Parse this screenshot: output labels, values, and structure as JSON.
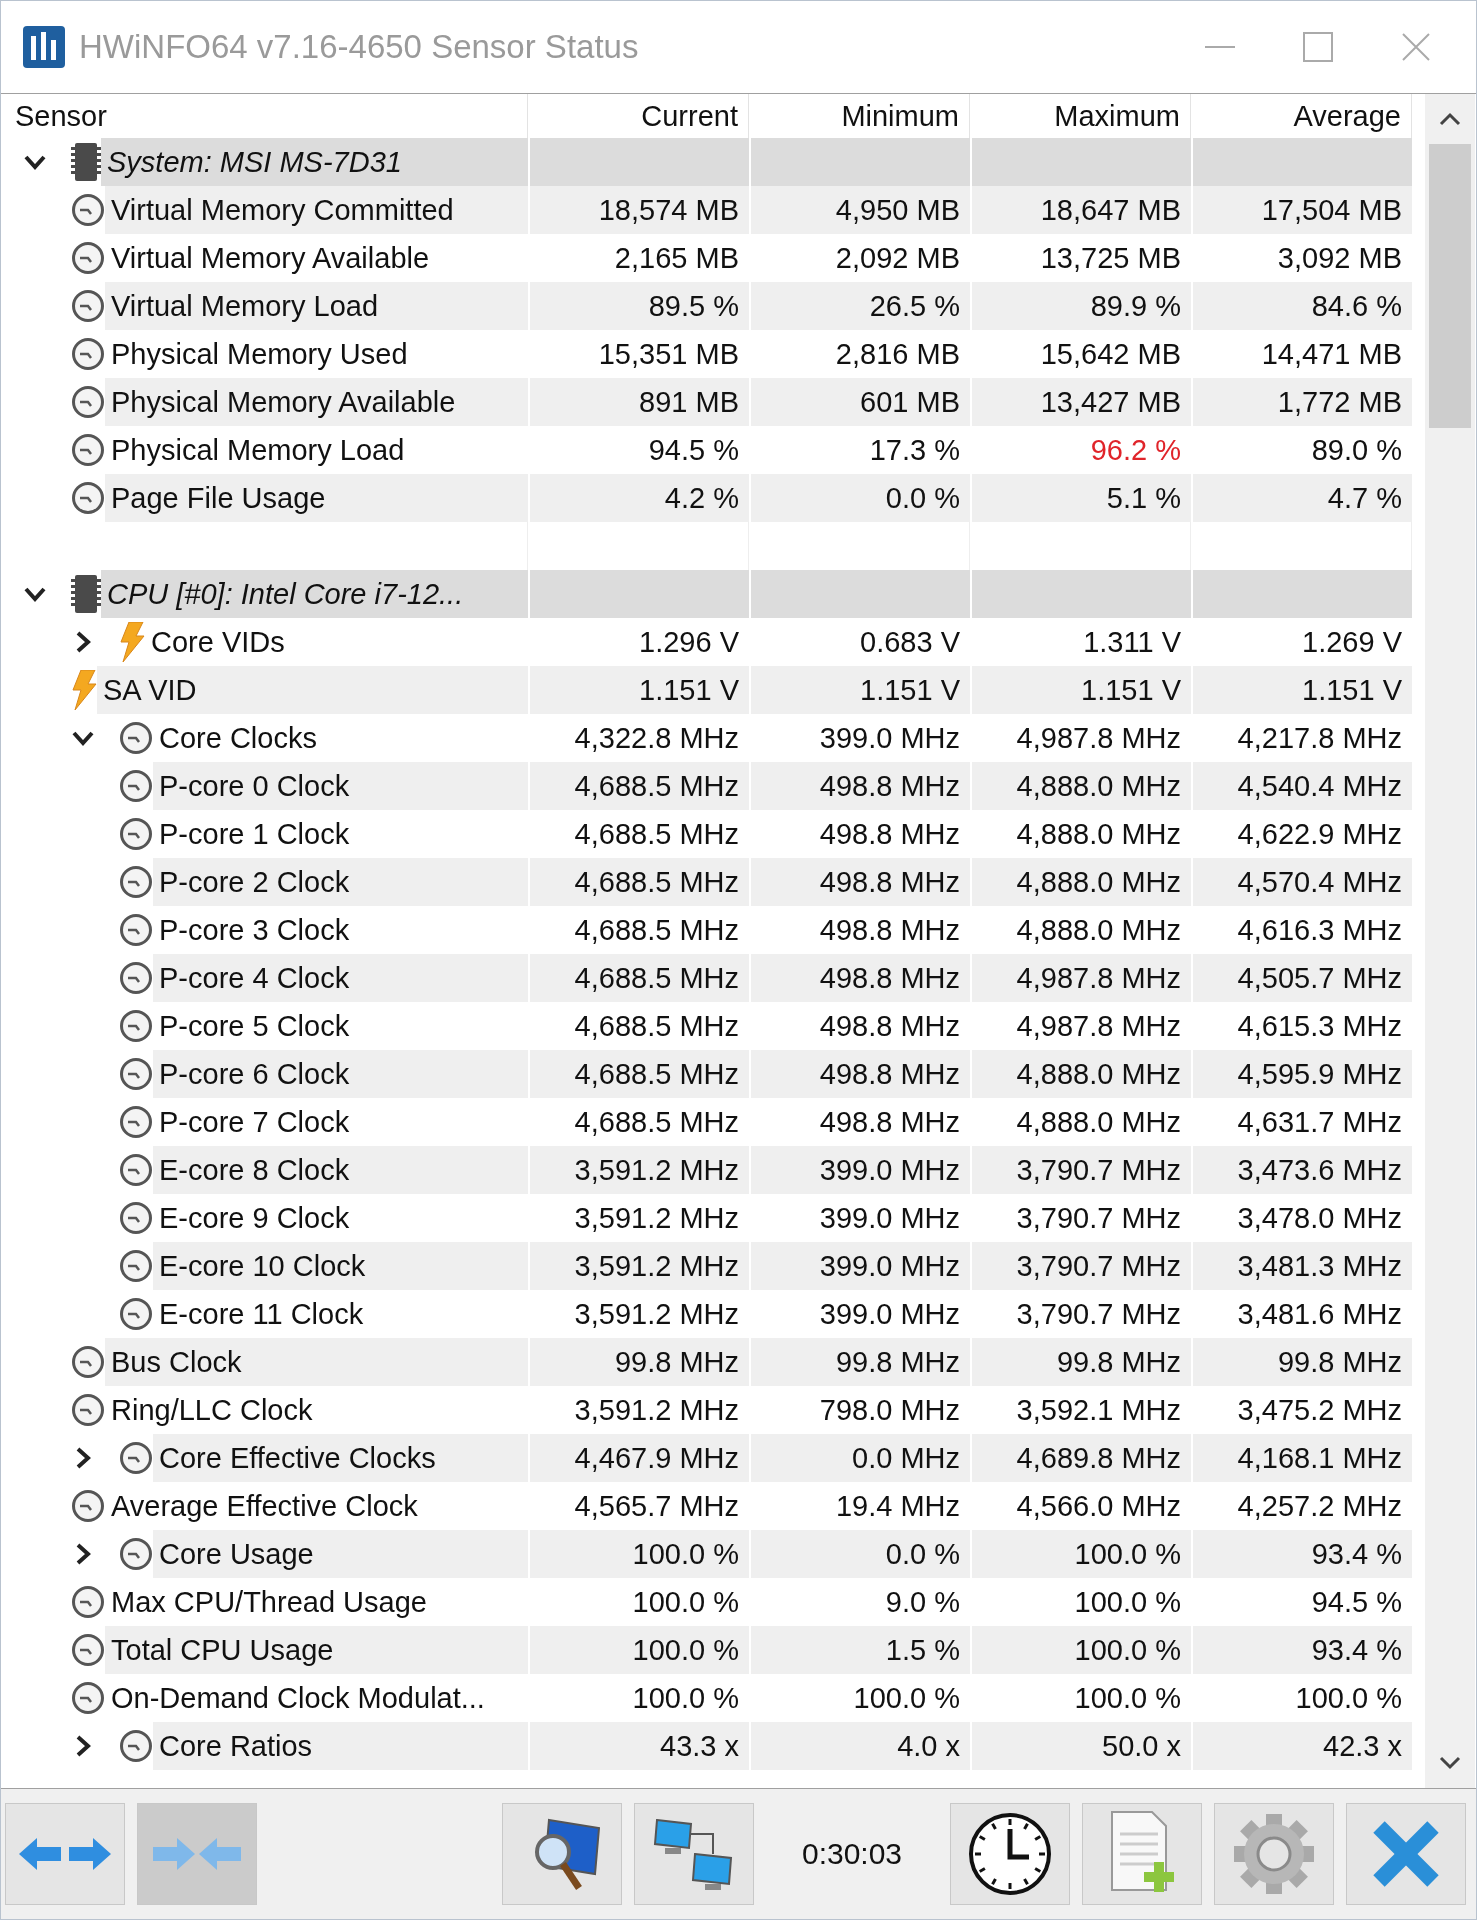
{
  "window": {
    "title": "HWiNFO64 v7.16-4650 Sensor Status"
  },
  "columns": [
    "Sensor",
    "Current",
    "Minimum",
    "Maximum",
    "Average"
  ],
  "groups": [
    {
      "label": "System: MSI MS-7D31",
      "expanded": true,
      "rows": [
        {
          "label": "Virtual Memory Committed",
          "kind": "clock",
          "values": [
            "18,574 MB",
            "4,950 MB",
            "18,647 MB",
            "17,504 MB"
          ],
          "max_alert": false
        },
        {
          "label": "Virtual Memory Available",
          "kind": "clock",
          "values": [
            "2,165 MB",
            "2,092 MB",
            "13,725 MB",
            "3,092 MB"
          ],
          "max_alert": false
        },
        {
          "label": "Virtual Memory Load",
          "kind": "clock",
          "values": [
            "89.5 %",
            "26.5 %",
            "89.9 %",
            "84.6 %"
          ],
          "max_alert": false
        },
        {
          "label": "Physical Memory Used",
          "kind": "clock",
          "values": [
            "15,351 MB",
            "2,816 MB",
            "15,642 MB",
            "14,471 MB"
          ],
          "max_alert": false
        },
        {
          "label": "Physical Memory Available",
          "kind": "clock",
          "values": [
            "891 MB",
            "601 MB",
            "13,427 MB",
            "1,772 MB"
          ],
          "max_alert": false
        },
        {
          "label": "Physical Memory Load",
          "kind": "clock",
          "values": [
            "94.5 %",
            "17.3 %",
            "96.2 %",
            "89.0 %"
          ],
          "max_alert": true
        },
        {
          "label": "Page File Usage",
          "kind": "clock",
          "values": [
            "4.2 %",
            "0.0 %",
            "5.1 %",
            "4.7 %"
          ],
          "max_alert": false
        }
      ]
    },
    {
      "label": "CPU [#0]: Intel Core i7-12...",
      "expanded": true,
      "rows": [
        {
          "label": "Core VIDs",
          "kind": "voltage",
          "expanded": false,
          "values": [
            "1.296 V",
            "0.683 V",
            "1.311 V",
            "1.269 V"
          ],
          "max_alert": false
        },
        {
          "label": "SA VID",
          "kind": "voltage",
          "values": [
            "1.151 V",
            "1.151 V",
            "1.151 V",
            "1.151 V"
          ],
          "max_alert": false
        },
        {
          "label": "Core Clocks",
          "kind": "clock",
          "expanded": true,
          "values": [
            "4,322.8 MHz",
            "399.0 MHz",
            "4,987.8 MHz",
            "4,217.8 MHz"
          ],
          "max_alert": false,
          "children": [
            {
              "label": "P-core 0 Clock",
              "kind": "clock",
              "values": [
                "4,688.5 MHz",
                "498.8 MHz",
                "4,888.0 MHz",
                "4,540.4 MHz"
              ],
              "max_alert": false
            },
            {
              "label": "P-core 1 Clock",
              "kind": "clock",
              "values": [
                "4,688.5 MHz",
                "498.8 MHz",
                "4,888.0 MHz",
                "4,622.9 MHz"
              ],
              "max_alert": false
            },
            {
              "label": "P-core 2 Clock",
              "kind": "clock",
              "values": [
                "4,688.5 MHz",
                "498.8 MHz",
                "4,888.0 MHz",
                "4,570.4 MHz"
              ],
              "max_alert": false
            },
            {
              "label": "P-core 3 Clock",
              "kind": "clock",
              "values": [
                "4,688.5 MHz",
                "498.8 MHz",
                "4,888.0 MHz",
                "4,616.3 MHz"
              ],
              "max_alert": false
            },
            {
              "label": "P-core 4 Clock",
              "kind": "clock",
              "values": [
                "4,688.5 MHz",
                "498.8 MHz",
                "4,987.8 MHz",
                "4,505.7 MHz"
              ],
              "max_alert": false
            },
            {
              "label": "P-core 5 Clock",
              "kind": "clock",
              "values": [
                "4,688.5 MHz",
                "498.8 MHz",
                "4,987.8 MHz",
                "4,615.3 MHz"
              ],
              "max_alert": false
            },
            {
              "label": "P-core 6 Clock",
              "kind": "clock",
              "values": [
                "4,688.5 MHz",
                "498.8 MHz",
                "4,888.0 MHz",
                "4,595.9 MHz"
              ],
              "max_alert": false
            },
            {
              "label": "P-core 7 Clock",
              "kind": "clock",
              "values": [
                "4,688.5 MHz",
                "498.8 MHz",
                "4,888.0 MHz",
                "4,631.7 MHz"
              ],
              "max_alert": false
            },
            {
              "label": "E-core 8 Clock",
              "kind": "clock",
              "values": [
                "3,591.2 MHz",
                "399.0 MHz",
                "3,790.7 MHz",
                "3,473.6 MHz"
              ],
              "max_alert": false
            },
            {
              "label": "E-core 9 Clock",
              "kind": "clock",
              "values": [
                "3,591.2 MHz",
                "399.0 MHz",
                "3,790.7 MHz",
                "3,478.0 MHz"
              ],
              "max_alert": false
            },
            {
              "label": "E-core 10 Clock",
              "kind": "clock",
              "values": [
                "3,591.2 MHz",
                "399.0 MHz",
                "3,790.7 MHz",
                "3,481.3 MHz"
              ],
              "max_alert": false
            },
            {
              "label": "E-core 11 Clock",
              "kind": "clock",
              "values": [
                "3,591.2 MHz",
                "399.0 MHz",
                "3,790.7 MHz",
                "3,481.6 MHz"
              ],
              "max_alert": false
            }
          ]
        },
        {
          "label": "Bus Clock",
          "kind": "clock",
          "values": [
            "99.8 MHz",
            "99.8 MHz",
            "99.8 MHz",
            "99.8 MHz"
          ],
          "max_alert": false
        },
        {
          "label": "Ring/LLC Clock",
          "kind": "clock",
          "values": [
            "3,591.2 MHz",
            "798.0 MHz",
            "3,592.1 MHz",
            "3,475.2 MHz"
          ],
          "max_alert": false
        },
        {
          "label": "Core Effective Clocks",
          "kind": "clock",
          "expanded": false,
          "values": [
            "4,467.9 MHz",
            "0.0 MHz",
            "4,689.8 MHz",
            "4,168.1 MHz"
          ],
          "max_alert": false
        },
        {
          "label": "Average Effective Clock",
          "kind": "clock",
          "values": [
            "4,565.7 MHz",
            "19.4 MHz",
            "4,566.0 MHz",
            "4,257.2 MHz"
          ],
          "max_alert": false
        },
        {
          "label": "Core Usage",
          "kind": "clock",
          "expanded": false,
          "values": [
            "100.0 %",
            "0.0 %",
            "100.0 %",
            "93.4 %"
          ],
          "max_alert": false
        },
        {
          "label": "Max CPU/Thread Usage",
          "kind": "clock",
          "values": [
            "100.0 %",
            "9.0 %",
            "100.0 %",
            "94.5 %"
          ],
          "max_alert": false
        },
        {
          "label": "Total CPU Usage",
          "kind": "clock",
          "values": [
            "100.0 %",
            "1.5 %",
            "100.0 %",
            "93.4 %"
          ],
          "max_alert": false
        },
        {
          "label": "On-Demand Clock Modulat...",
          "kind": "clock",
          "values": [
            "100.0 %",
            "100.0 %",
            "100.0 %",
            "100.0 %"
          ],
          "max_alert": false
        },
        {
          "label": "Core Ratios",
          "kind": "clock",
          "expanded": false,
          "values": [
            "43.3 x",
            "4.0 x",
            "50.0 x",
            "42.3 x"
          ],
          "max_alert": false
        }
      ]
    }
  ],
  "toolbar": {
    "left_buttons": [
      {
        "kind": "expand",
        "pressed": false
      },
      {
        "kind": "collapse",
        "pressed": true
      }
    ],
    "view_buttons": [
      {
        "kind": "search",
        "pressed": false
      },
      {
        "kind": "network",
        "pressed": false
      }
    ],
    "timer": "0:30:03",
    "action_buttons": [
      {
        "kind": "clock",
        "pressed": false
      },
      {
        "kind": "report",
        "pressed": false
      },
      {
        "kind": "settings",
        "pressed": false
      },
      {
        "kind": "close",
        "pressed": false
      }
    ]
  }
}
